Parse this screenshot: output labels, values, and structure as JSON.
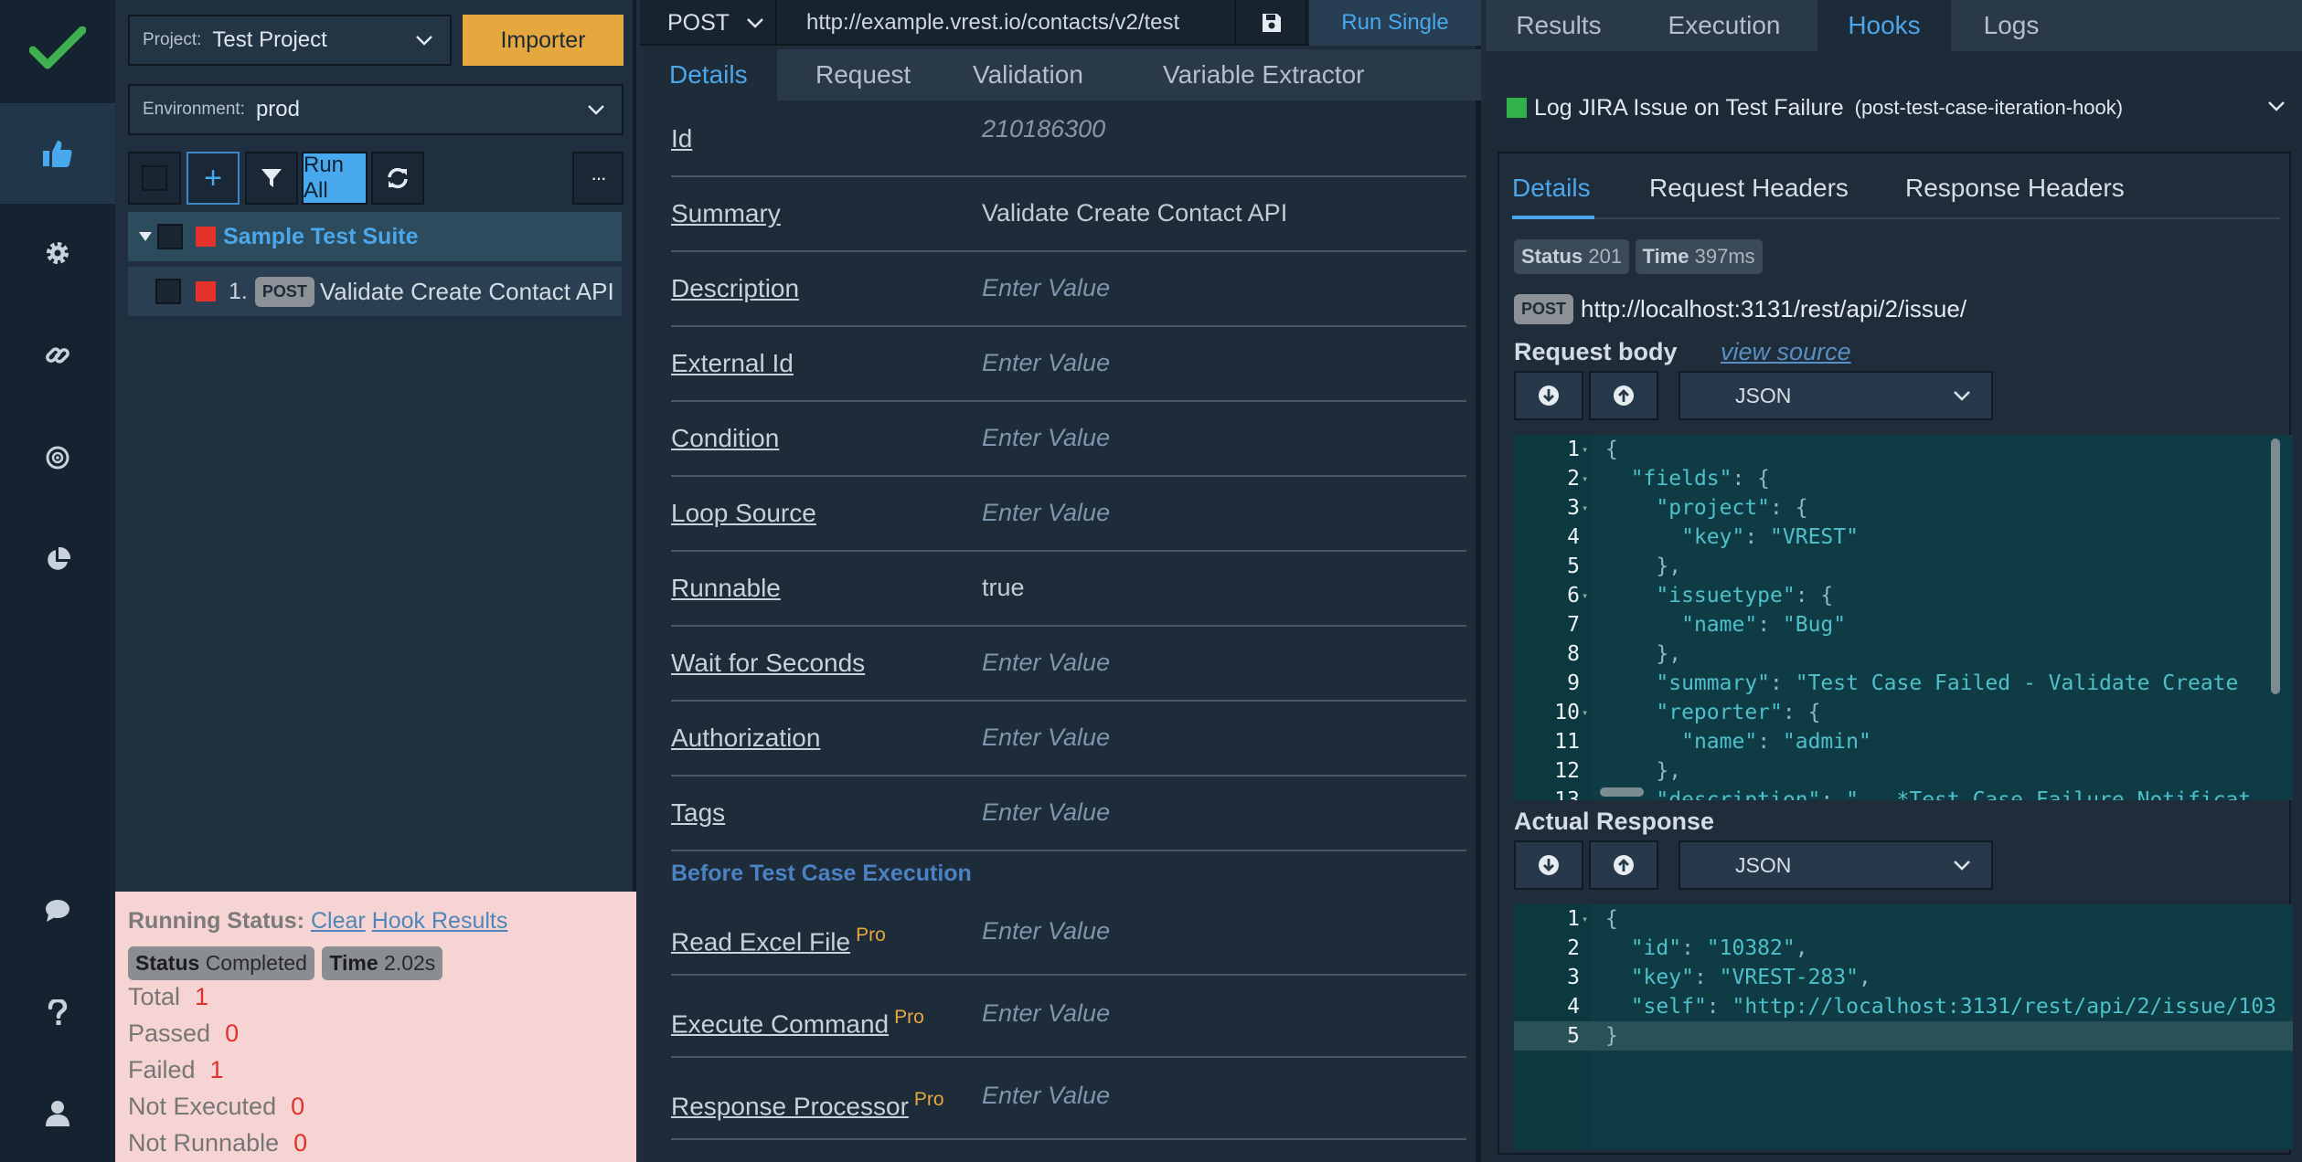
{
  "rail": {
    "colors": {
      "logo_check": "#3fb04f",
      "active_icon": "#49a9ee",
      "icon": "#c9d2da"
    },
    "items": [
      {
        "name": "logo-check-icon"
      },
      {
        "name": "thumbs-up-icon"
      },
      {
        "name": "gear-icon"
      },
      {
        "name": "link-icon"
      },
      {
        "name": "target-icon"
      },
      {
        "name": "pie-chart-icon"
      },
      {
        "name": "chat-icon"
      },
      {
        "name": "help-icon"
      },
      {
        "name": "user-icon"
      }
    ]
  },
  "tc_panel": {
    "project_label": "Project:",
    "project_value": "Test Project",
    "importer_label": "Importer",
    "environment_label": "Environment:",
    "environment_value": "prod",
    "add_label": "+",
    "run_all_label": "Run All",
    "more_label": "···",
    "suite_name": "Sample Test Suite",
    "test_case": {
      "index": "1.",
      "method": "POST",
      "name": "Validate Create Contact API"
    }
  },
  "running_status": {
    "label": "Running Status:",
    "clear_link": "Clear",
    "hook_results_link": "Hook Results",
    "status_key": "Status",
    "status_value": "Completed",
    "time_key": "Time",
    "time_value": "2.02s",
    "counts": [
      {
        "label": "Total",
        "value": "1"
      },
      {
        "label": "Passed",
        "value": "0"
      },
      {
        "label": "Failed",
        "value": "1"
      },
      {
        "label": "Not Executed",
        "value": "0"
      },
      {
        "label": "Not Runnable",
        "value": "0"
      }
    ]
  },
  "details": {
    "method": "POST",
    "url": "http://example.vrest.io/contacts/v2/test",
    "run_single_label": "Run Single",
    "tabs": [
      "Details",
      "Request",
      "Validation",
      "Variable Extractor"
    ],
    "fields": [
      {
        "label": "Id",
        "value": "210186300",
        "kind": "id"
      },
      {
        "label": "Summary",
        "value": "Validate Create Contact API",
        "kind": "val"
      },
      {
        "label": "Description",
        "value": "Enter Value",
        "kind": "ph"
      },
      {
        "label": "External Id",
        "value": "Enter Value",
        "kind": "ph"
      },
      {
        "label": "Condition",
        "value": "Enter Value",
        "kind": "ph"
      },
      {
        "label": "Loop Source",
        "value": "Enter Value",
        "kind": "ph"
      },
      {
        "label": "Runnable",
        "value": "true",
        "kind": "val"
      },
      {
        "label": "Wait for Seconds",
        "value": "Enter Value",
        "kind": "ph"
      },
      {
        "label": "Authorization",
        "value": "Enter Value",
        "kind": "ph"
      },
      {
        "label": "Tags",
        "value": "Enter Value",
        "kind": "ph"
      }
    ],
    "section_title": "Before Test Case Execution",
    "pro_fields": [
      {
        "label": "Read Excel File",
        "badge": "Pro",
        "value": "Enter Value"
      },
      {
        "label": "Execute Command",
        "badge": "Pro",
        "value": "Enter Value"
      },
      {
        "label": "Response Processor",
        "badge": "Pro",
        "value": "Enter Value"
      }
    ]
  },
  "right": {
    "tabs": [
      "Results",
      "Execution",
      "Hooks",
      "Logs"
    ],
    "active_tab": "Hooks",
    "hook_title": "Log JIRA Issue on Test Failure",
    "hook_type": "(post-test-case-iteration-hook)",
    "sub_tabs": [
      "Details",
      "Request Headers",
      "Response Headers"
    ],
    "status_key": "Status",
    "status_value": "201",
    "time_key": "Time",
    "time_value": "397ms",
    "request_method": "POST",
    "request_url": "http://localhost:3131/rest/api/2/issue/",
    "request_body_label": "Request body",
    "view_source_label": "view source",
    "body_format": "JSON",
    "request_body_lines": [
      "{",
      "  \"fields\": {",
      "    \"project\": {",
      "      \"key\": \"VREST\"",
      "    },",
      "    \"issuetype\": {",
      "      \"name\": \"Bug\"",
      "    },",
      "    \"summary\": \"Test Case Failed - Validate Create",
      "    \"reporter\": {",
      "      \"name\": \"admin\"",
      "    },",
      "    \"description\": \"...*Test Case Failure Notificat"
    ],
    "actual_response_label": "Actual Response",
    "response_format": "JSON",
    "response_lines": [
      "{",
      "  \"id\": \"10382\",",
      "  \"key\": \"VREST-283\",",
      "  \"self\": \"http://localhost:3131/rest/api/2/issue/103",
      "}"
    ]
  }
}
